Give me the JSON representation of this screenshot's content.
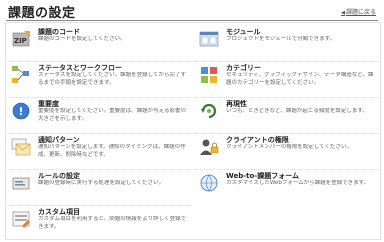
{
  "header": {
    "title": "課題の設定",
    "back_link": "課題に戻る"
  },
  "items_left": [
    {
      "title": "課題のコード",
      "desc": "課題のコードを設定してください。",
      "icon": "zip-code-icon"
    },
    {
      "title": "ステータスとワークフロー",
      "desc": "ステータスを設定してください。課題を登録してから完了するまでの手順を設定できます。",
      "icon": "workflow-icon"
    },
    {
      "title": "重要度",
      "desc": "重要度を設定してください。重要度は、課題が与える影響の大きさを示します。",
      "icon": "importance-icon"
    },
    {
      "title": "通知パターン",
      "desc": "通知パターンを設定します。通知のタイミングは、課題の作成、更新、削除時などです。",
      "icon": "notification-icon"
    },
    {
      "title": "ルールの設定",
      "desc": "課題の登録時に実行する処理を設定してください。",
      "icon": "rule-icon"
    },
    {
      "title": "カスタム項目",
      "desc": "カスタム項目を利用すると、問題の情報をより詳しく登録できます。",
      "icon": "custom-field-icon"
    }
  ],
  "items_right": [
    {
      "title": "モジュール",
      "desc": "プロジェクトをモジュールで分類できます。",
      "icon": "module-icon"
    },
    {
      "title": "カテゴリー",
      "desc": "セキュリティ、グラフィックデザイン、データ構造など、課題のカテゴリーを設定してください。",
      "icon": "category-icon"
    },
    {
      "title": "再現性",
      "desc": "いつも、ときどきなど、課題が起こる頻度を設定します。",
      "icon": "reproducibility-icon"
    },
    {
      "title": "クライアントの権限",
      "desc": "クライアントメンバーの権限を設定してください。",
      "icon": "client-permission-icon"
    },
    {
      "title": "Web-to-課題フォーム",
      "desc": "カスタマイズしたWebフォームから課題を登録できます。",
      "icon": "web-form-icon"
    }
  ]
}
